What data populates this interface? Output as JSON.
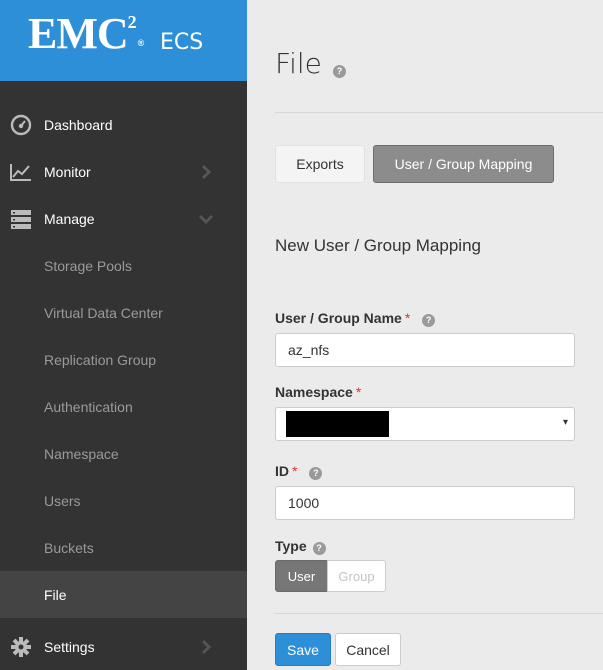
{
  "brand": {
    "logo": "EMC",
    "logo_sup": "2",
    "logo_reg": "®",
    "product": "ECS"
  },
  "sidebar": {
    "dashboard": "Dashboard",
    "monitor": "Monitor",
    "manage": "Manage",
    "sub_items": [
      "Storage Pools",
      "Virtual Data Center",
      "Replication Group",
      "Authentication",
      "Namespace",
      "Users",
      "Buckets",
      "File"
    ],
    "settings": "Settings"
  },
  "main": {
    "title": "File",
    "help_glyph": "?",
    "tabs": {
      "exports": "Exports",
      "mapping": "User / Group Mapping"
    },
    "section_title": "New User / Group Mapping",
    "fields": {
      "name_label": "User / Group Name",
      "name_value": "az_nfs",
      "namespace_label": "Namespace",
      "namespace_caret": "▾",
      "id_label": "ID",
      "id_value": "1000",
      "type_label": "Type",
      "required_mark": "*"
    },
    "type_options": {
      "user": "User",
      "group": "Group"
    },
    "buttons": {
      "save": "Save",
      "cancel": "Cancel"
    }
  },
  "colors": {
    "brand_blue": "#2c8fd8",
    "sidebar_bg": "#333333",
    "active_bg": "#444444",
    "required": "#e0312f"
  }
}
